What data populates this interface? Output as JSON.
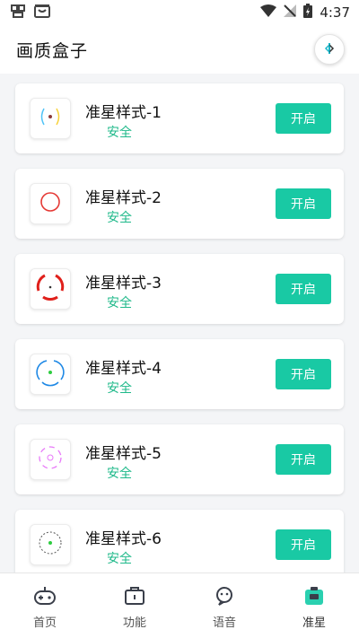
{
  "status_bar": {
    "time": "4:37"
  },
  "header": {
    "title": "画质盒子"
  },
  "crosshairs": [
    {
      "title": "准星样式-1",
      "status": "安全",
      "button": "开启"
    },
    {
      "title": "准星样式-2",
      "status": "安全",
      "button": "开启"
    },
    {
      "title": "准星样式-3",
      "status": "安全",
      "button": "开启"
    },
    {
      "title": "准星样式-4",
      "status": "安全",
      "button": "开启"
    },
    {
      "title": "准星样式-5",
      "status": "安全",
      "button": "开启"
    },
    {
      "title": "准星样式-6",
      "status": "安全",
      "button": "开启"
    }
  ],
  "bottom_nav": [
    {
      "label": "首页",
      "icon": "gamepad-icon"
    },
    {
      "label": "功能",
      "icon": "toolbox-icon"
    },
    {
      "label": "语音",
      "icon": "chat-face-icon"
    },
    {
      "label": "准星",
      "icon": "crosshair-box-icon",
      "active": true
    }
  ],
  "colors": {
    "accent": "#19c9a4",
    "status_safe": "#1fb98a",
    "nav_active": "#2ad0b0"
  }
}
